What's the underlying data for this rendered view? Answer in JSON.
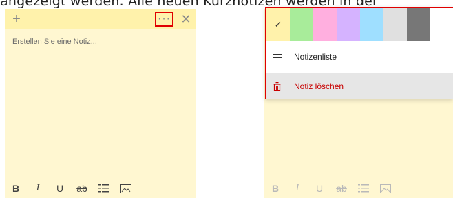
{
  "caption": "angezeigt werden. Alle neuen Kurznotizen werden in der",
  "left_note": {
    "placeholder": "Erstellen Sie eine Notiz...",
    "add_glyph": "+",
    "more_glyph": "···",
    "close_glyph": "✕"
  },
  "format_bar": {
    "bold": "B",
    "italic": "I",
    "underline": "U",
    "strike": "ab"
  },
  "menu": {
    "colors": [
      "#fff2ab",
      "#a8ec9a",
      "#ffafdf",
      "#d5b3ff",
      "#9fdfff",
      "#e0e0e0",
      "#777777"
    ],
    "selected_color_index": 0,
    "check_glyph": "✓",
    "notes_list_label": "Notizenliste",
    "delete_label": "Notiz löschen",
    "delete_color": "#c80000",
    "highlight_color": "#e00000"
  }
}
